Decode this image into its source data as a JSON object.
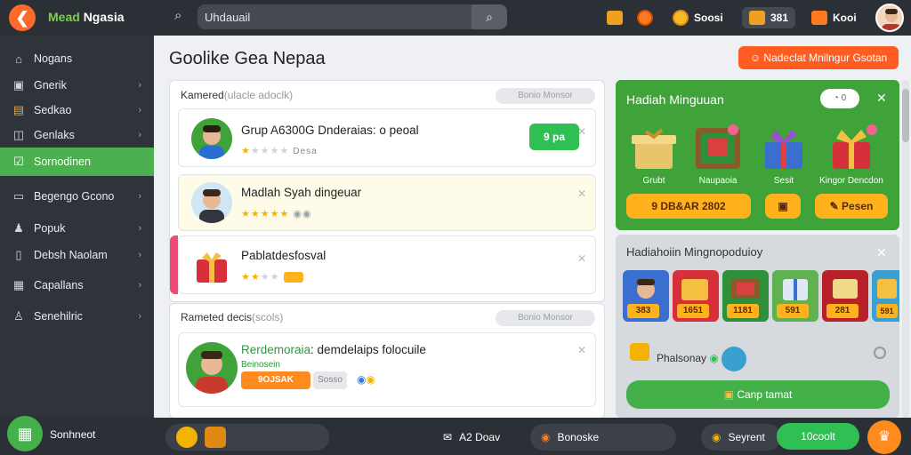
{
  "topbar": {
    "app_title_a": "Mead ",
    "app_title_b": "Ngasia",
    "search_value": "Uhdauail",
    "stat1": "",
    "stat2": "",
    "stat3_value": "Soosi",
    "stat4_value": "381",
    "stat5_value": "Kooi"
  },
  "sidebar": {
    "items": [
      {
        "label": "Nogans",
        "icon": "home-icon"
      },
      {
        "label": "Gnerik",
        "icon": "gamepad-icon"
      },
      {
        "label": "Sedkao",
        "icon": "chest-icon"
      },
      {
        "label": "Genlaks",
        "icon": "chart-icon"
      },
      {
        "label": "Sornodinen",
        "icon": "check-icon"
      },
      {
        "label": "Begengo Gcono",
        "icon": "card-icon"
      },
      {
        "label": "Popuk",
        "icon": "user-icon"
      },
      {
        "label": "Debsh Naolam",
        "icon": "doc-icon"
      },
      {
        "label": "Capallans",
        "icon": "table-icon"
      },
      {
        "label": "Senehilric",
        "icon": "person-icon"
      }
    ]
  },
  "main": {
    "title": "Goolike Gea Nepaa",
    "cta": "Nadeclat Mnilngur Gsotan",
    "panel1": {
      "heading": "Kamered",
      "heading_sub": "(ulacle adoclk)",
      "pill": "Bonio   Monsor"
    },
    "cards": [
      {
        "title": "Grup A6300G  Dnderaias",
        "suffix": ": o peoal",
        "meta": "Desa",
        "rating": 1,
        "button": "9 pa"
      },
      {
        "title": "Madlah Syah dingeuar",
        "meta": "",
        "rating": 5
      },
      {
        "title": "Pablatdesfosval",
        "meta": "",
        "rating": 2
      }
    ],
    "panel2": {
      "heading": "Rameted decis",
      "heading_sub": "(scols)",
      "pill": "Bonio   Monsor"
    },
    "card4": {
      "title": "Rerdemoraia",
      "title_b": ": demdelaips folocuile",
      "meta_green": "Beinosein",
      "chip": "9OJSAK",
      "chip2": "Sosso"
    }
  },
  "gifts_panel": {
    "title": "Hadiah Minguuan",
    "toggle": "0",
    "labels": [
      "Grubt",
      "Naupaoia",
      "Sesit",
      "Kingor Dencdon"
    ],
    "btn1": "9 DB&AR 2802",
    "btn2": "",
    "btn3": "Pesen"
  },
  "rewards_panel": {
    "title": "Hadiahoiin Mingnopoduioy",
    "prices": [
      "383",
      "1651",
      "1181",
      "591",
      "281",
      "591"
    ],
    "row_label": "Phalsonay",
    "button": "Canp tamat"
  },
  "bottombar": {
    "home_label": "Sonhneot",
    "pill1": "",
    "pill2": "A2 Doav",
    "pill3": "Bonoske",
    "pill4": "Seyrent",
    "green": "10coolt"
  },
  "colors": {
    "accent_green": "#43b049",
    "accent_orange": "#ff5c21",
    "dark": "#2b2f36"
  }
}
